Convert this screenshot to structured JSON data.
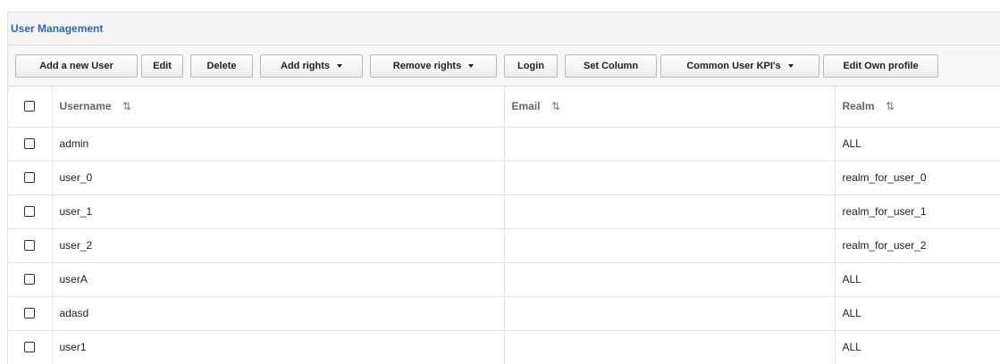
{
  "panel": {
    "title": "User Management"
  },
  "toolbar": {
    "buttons": [
      {
        "label": "Add a new User",
        "dropdown": false
      },
      {
        "label": "Edit",
        "dropdown": false
      },
      {
        "label": "Delete",
        "dropdown": false
      },
      {
        "label": "Add rights",
        "dropdown": true
      },
      {
        "label": "Remove rights",
        "dropdown": true
      },
      {
        "label": "Login",
        "dropdown": false
      },
      {
        "label": "Set Column",
        "dropdown": false
      },
      {
        "label": "Common User KPI's",
        "dropdown": true
      },
      {
        "label": "Edit Own profile",
        "dropdown": false
      }
    ]
  },
  "table": {
    "columns": [
      "Username",
      "Email",
      "Realm"
    ],
    "sort_icon": "⇅",
    "rows": [
      {
        "username": "admin",
        "email": "",
        "realm": "ALL"
      },
      {
        "username": "user_0",
        "email": "",
        "realm": "realm_for_user_0"
      },
      {
        "username": "user_1",
        "email": "",
        "realm": "realm_for_user_1"
      },
      {
        "username": "user_2",
        "email": "",
        "realm": "realm_for_user_2"
      },
      {
        "username": "userA",
        "email": "",
        "realm": "ALL"
      },
      {
        "username": "adasd",
        "email": "",
        "realm": "ALL"
      },
      {
        "username": "user1",
        "email": "",
        "realm": "ALL"
      }
    ]
  },
  "colors": {
    "title": "#2a6ab0",
    "header_bg": "#f5f5f5",
    "border": "#e3e3e3"
  }
}
